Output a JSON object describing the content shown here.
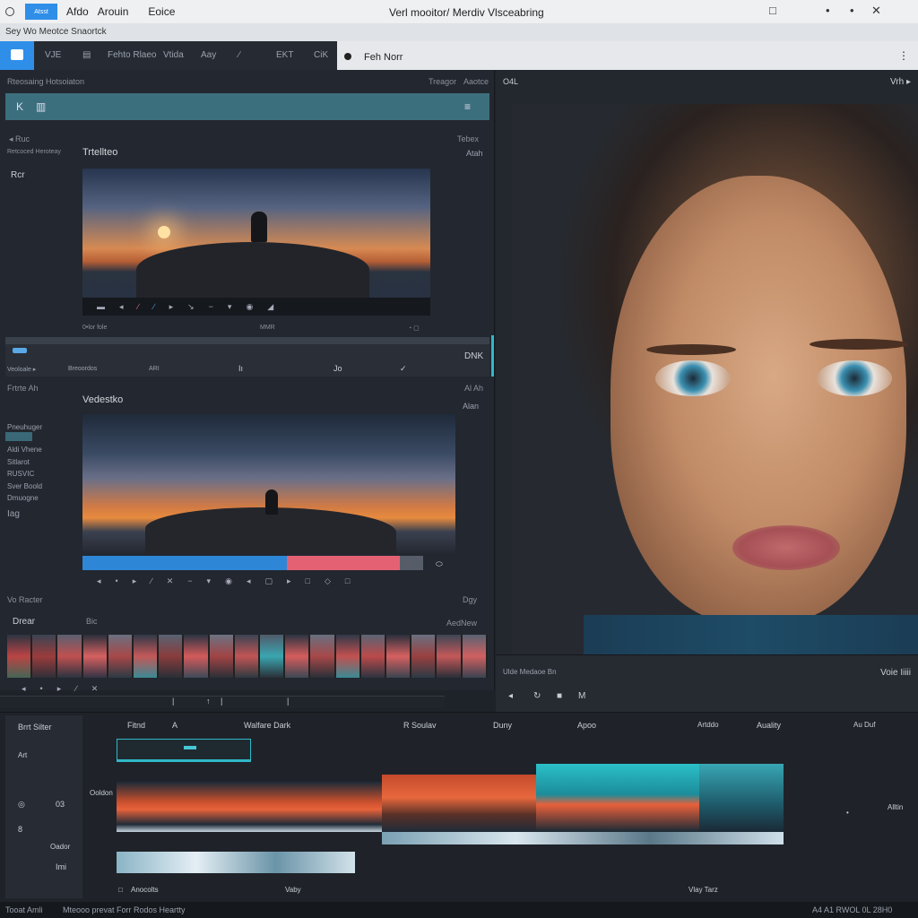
{
  "titlebar": {
    "logo_label": "Atsst",
    "menus": [
      "Afdo",
      "Arouin",
      "Eoice"
    ],
    "title": "Verl mooitor/ Merdiv Vlsceabring",
    "win_controls": [
      "□",
      "•",
      "•",
      "✕"
    ]
  },
  "subbar": {
    "text": "Sey Wo Meotce Snaortck"
  },
  "toolbar": {
    "items": [
      "VJE",
      "▤",
      "Fehto Rlaeo",
      "Vtida",
      "Aay",
      "∕",
      "EKT",
      "CiK"
    ]
  },
  "doc_tab": {
    "label": "Feh Norr",
    "more": "⋮"
  },
  "left_panel": {
    "header": "Rteosaing Hotsoiaton",
    "header_right": [
      "Treagor",
      "Aaotce"
    ],
    "cyan_icons": [
      "K",
      "▥"
    ],
    "cyan_right": "≡",
    "section1": {
      "title": "Trtellteo",
      "side_label": "Rcr",
      "top_left": "◂ Ruc",
      "top_left2": "Retcoced Heroteay",
      "right_label": "Atah",
      "top_right": "Tebex",
      "strip_footer": [
        "0•lor fole",
        "MMR",
        "◔ ▢"
      ]
    },
    "scrubber": {
      "left": [
        "Veoloale ▸",
        "Breoordos",
        "ARI"
      ],
      "icons": [
        "Iı",
        "Jo",
        "✓"
      ],
      "right": "DNK"
    },
    "section2": {
      "title": "Vedestko",
      "top_left": "Frtrte Ah",
      "right_label": "Alan",
      "top_right": "Al Ah",
      "sidebar": [
        "Pneuhuger",
        "Aldi Vhene",
        "Sitlarot",
        "RUSVIC",
        "Sver Boold",
        "Dmuogne",
        "Iag"
      ]
    },
    "section3": {
      "label1": "Vo Racter",
      "label2": "Drear",
      "label3": "Bic",
      "right1": "Dgy",
      "right2": "AedNew"
    }
  },
  "preview": {
    "label": "O4L",
    "label_right": "Vrh ▸",
    "bottom_left": "Ulde  Medaoe Bn",
    "bottom_right": "Voie  Iiiii",
    "controls": [
      "◂",
      "↻",
      "■",
      "M"
    ]
  },
  "timeline": {
    "tracklist_title": "Brrt Silter",
    "tracklist_items": [
      "Art",
      "◎",
      "03",
      "8",
      "Oador",
      "Imi"
    ],
    "ruler": [
      "Fitnd",
      "A",
      "Walfare Dark",
      "R Soulav",
      "Duny",
      "Apoo",
      "Artddo",
      "Auality",
      "Au Duf"
    ],
    "track_label": "Ooldon",
    "right_label": "Alltin",
    "footer_left": "Anocolts",
    "footer_mid": "Vaby",
    "footer_right": "Vlay Tarz"
  },
  "statusbar": {
    "left": "Tooat Amli",
    "middle": "Mteooo prevat Forr Rodos Heartty",
    "right": "A4 A1 RWOL 0L 28H0"
  }
}
